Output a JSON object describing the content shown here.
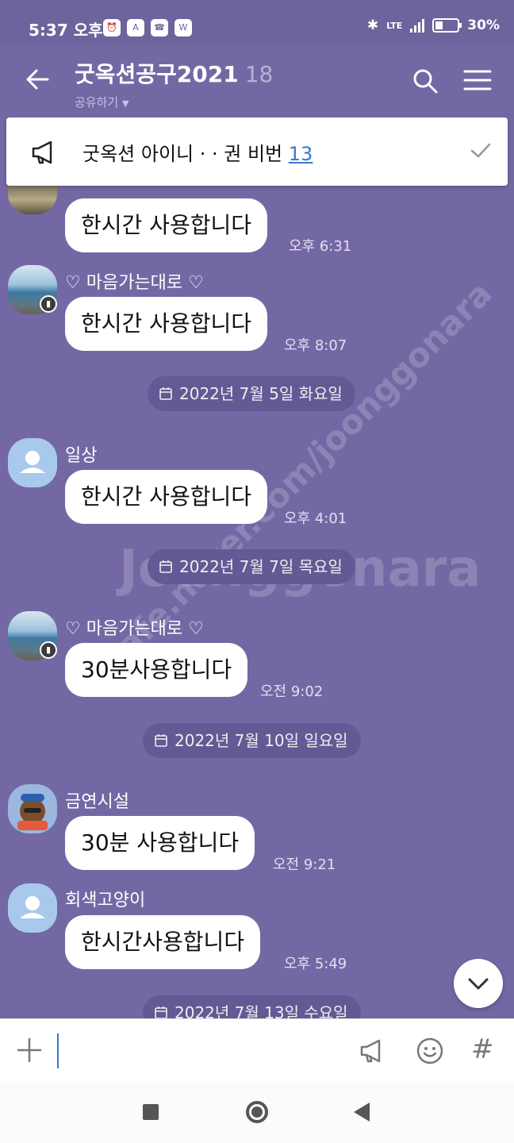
{
  "status_bar": {
    "time": "5:37 오후",
    "battery": "30%",
    "network": "LTE"
  },
  "header": {
    "title": "굿옥션공구2021",
    "member_count": "18",
    "subtitle": "공유하기"
  },
  "notice": {
    "text": "굿옥션 아이니 · · 권 비번 ",
    "link_text": "13"
  },
  "messages": [
    {
      "sender": "",
      "text": "한시간 사용합니다",
      "time": "오후 6:31"
    },
    {
      "sender": "♡ 마음가는대로 ♡",
      "text": "한시간 사용합니다",
      "time": "오후 8:07"
    },
    {
      "date": "2022년 7월 5일 화요일"
    },
    {
      "sender": "일상",
      "text": "한시간 사용합니다",
      "time": "오후 4:01"
    },
    {
      "date": "2022년 7월 7일 목요일"
    },
    {
      "sender": "♡ 마음가는대로 ♡",
      "text": "30분사용합니다",
      "time": "오전 9:02"
    },
    {
      "date": "2022년 7월 10일 일요일"
    },
    {
      "sender": "금연시설",
      "text": "30분 사용합니다",
      "time": "오전 9:21"
    },
    {
      "sender": "회색고양이",
      "text": "한시간사용합니다",
      "time": "오후 5:49"
    },
    {
      "date": "2022년 7월 13일 수요일"
    }
  ],
  "watermark": {
    "text1": "cafe.naver.com/joonggonara",
    "text2": "Joonggonara"
  },
  "colors": {
    "background": "#7468a4",
    "status_bar": "#6e639c",
    "date_pill": "#645994",
    "link": "#3a78c9"
  }
}
